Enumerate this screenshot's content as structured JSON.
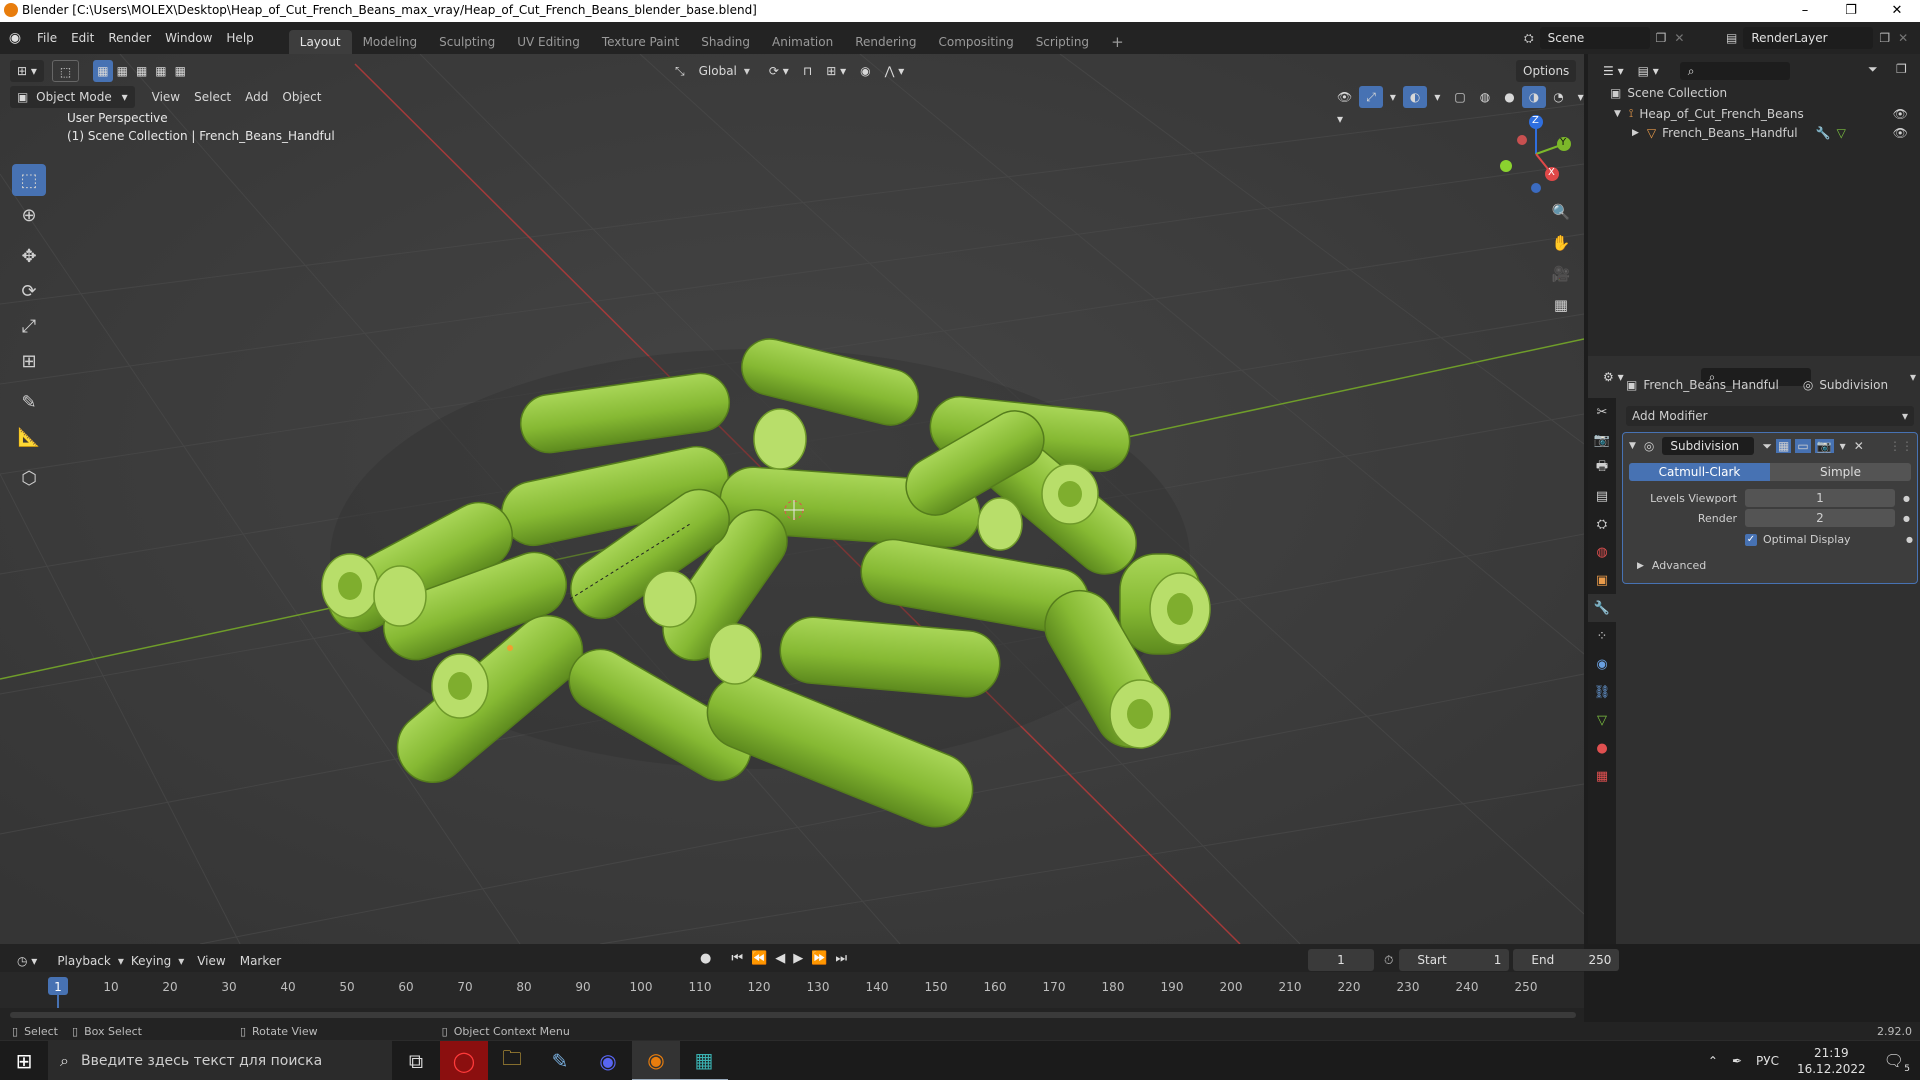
{
  "window": {
    "title": "Blender [C:\\Users\\MOLEX\\Desktop\\Heap_of_Cut_French_Beans_max_vray/Heap_of_Cut_French_Beans_blender_base.blend]",
    "minimize": "–",
    "restore": "❐",
    "close": "✕"
  },
  "menubar": {
    "items": [
      "File",
      "Edit",
      "Render",
      "Window",
      "Help"
    ],
    "workspaces": [
      "Layout",
      "Modeling",
      "Sculpting",
      "UV Editing",
      "Texture Paint",
      "Shading",
      "Animation",
      "Rendering",
      "Compositing",
      "Scripting"
    ],
    "add_tab": "+",
    "scene_label": "Scene",
    "render_layer_label": "RenderLayer"
  },
  "viewport": {
    "header": {
      "mode": "Object Mode",
      "menus": [
        "View",
        "Select",
        "Add",
        "Object"
      ],
      "transform_orientation": "Global",
      "options": "Options"
    },
    "overlay_text": {
      "perspective": "User Perspective",
      "collection": "(1) Scene Collection | French_Beans_Handful"
    },
    "gizmo": {
      "z": "Z",
      "y": "Y",
      "x": "X"
    }
  },
  "outliner": {
    "root": "Scene Collection",
    "items": [
      {
        "label": "Heap_of_Cut_French_Beans"
      },
      {
        "label": "French_Beans_Handful"
      }
    ]
  },
  "properties": {
    "object_name": "French_Beans_Handful",
    "modifier_label": "Subdivision",
    "add_modifier": "Add Modifier",
    "modifier": {
      "name": "Subdivision",
      "mode_catmull": "Catmull-Clark",
      "mode_simple": "Simple",
      "levels_viewport_label": "Levels Viewport",
      "levels_viewport_value": "1",
      "render_label": "Render",
      "render_value": "2",
      "optimal_display": "Optimal Display",
      "advanced": "Advanced"
    }
  },
  "timeline": {
    "menus": [
      "Playback",
      "Keying",
      "View",
      "Marker"
    ],
    "current_frame": "1",
    "start_label": "Start",
    "start_value": "1",
    "end_label": "End",
    "end_value": "250",
    "ticks": [
      "1",
      "10",
      "20",
      "30",
      "40",
      "50",
      "60",
      "70",
      "80",
      "90",
      "100",
      "110",
      "120",
      "130",
      "140",
      "150",
      "160",
      "170",
      "180",
      "190",
      "200",
      "210",
      "220",
      "230",
      "240",
      "250"
    ]
  },
  "statusbar": {
    "select": "Select",
    "box_select": "Box Select",
    "rotate_view": "Rotate View",
    "context_menu": "Object Context Menu",
    "version": "2.92.0"
  },
  "taskbar": {
    "search_placeholder": "Введите здесь текст для поиска",
    "lang": "РУС",
    "time": "21:19",
    "date": "16.12.2022",
    "notif": "5"
  },
  "colors": {
    "accent": "#4772b3",
    "bean_green": "#8fc23b",
    "x_axis": "#a33a3a",
    "y_axis": "#6f9d2a"
  }
}
